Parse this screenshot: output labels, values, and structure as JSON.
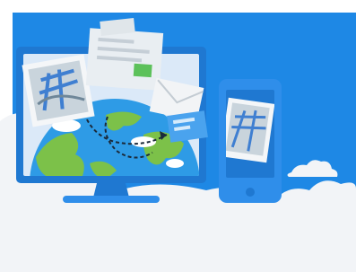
{
  "illustration": {
    "title": "",
    "icons": [
      "cloud-icon",
      "monitor-icon",
      "globe-icon",
      "phone-icon",
      "map-photo-icon",
      "mail-envelope-icon",
      "document-icon",
      "transfer-arrow-icon"
    ],
    "colors": {
      "sky": "#1e88e5",
      "sky_dark": "#1565c0",
      "device_blue": "#2f8eea",
      "device_frame": "#1f78d1",
      "screen_light": "#dbe9f8",
      "ocean": "#2e9be6",
      "land": "#7cc149",
      "cloud": "#f2f4f7",
      "paper": "#e9eef2",
      "accent_green": "#5cc15a"
    }
  }
}
